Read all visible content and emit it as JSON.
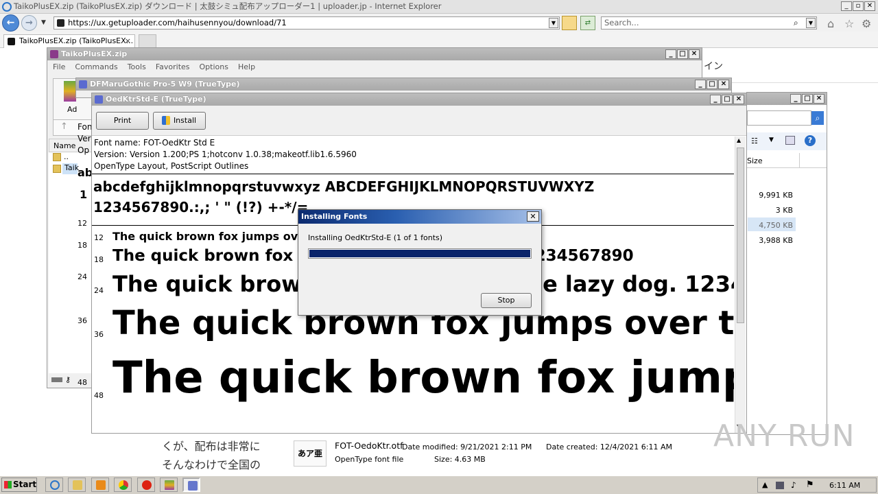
{
  "browser": {
    "title": "TaikoPlusEX.zip (TaikoPlusEX.zip) ダウンロード | 太鼓シミュ配布アップローダー1 | uploader.jp - Internet Explorer",
    "address": "https://ux.getuploader.com/haihusennyou/download/71",
    "search_placeholder": "Search...",
    "tab_label": "TaikoPlusEX.zip (TaikoPlusEX...",
    "tab_close": "×"
  },
  "page": {
    "text_right": "イン",
    "text_line1": "くが、配布は非常に",
    "text_line2": "そんなわけで全国の"
  },
  "winrar": {
    "title": "TaikoPlusEX.zip",
    "menu": [
      "File",
      "Commands",
      "Tools",
      "Favorites",
      "Options",
      "Help"
    ],
    "add_label": "Ad",
    "col_name": "Name",
    "row1": "..",
    "row2": "Taik",
    "left_labels": [
      "Fon",
      "Ver",
      "Op",
      "ab",
      "1",
      "12",
      "18",
      "24",
      "36",
      "48"
    ]
  },
  "dfmaru": {
    "title": "DFMaruGothic Pro-5 W9 (TrueType)"
  },
  "fontviewer": {
    "title": "OedKtrStd-E (TrueType)",
    "print_label": "Print",
    "install_label": "Install",
    "font_name": "Font name: FOT-OedKtr Std E",
    "version": "Version: Version 1.200;PS 1;hotconv 1.0.38;makeotf.lib1.6.5960",
    "outline": "OpenType Layout, PostScript Outlines",
    "charset1": "abcdefghijklmnopqrstuvwxyz ABCDEFGHIJKLMNOPQRSTUVWXYZ",
    "charset2": "1234567890.:,; ' \" (!?) +-*/=",
    "samples": [
      {
        "size": "12",
        "text": "The quick brown fox jumps over the lazy dog. 1234567890"
      },
      {
        "size": "18",
        "text": "The quick brown fox jumps over the lazy dog. 1234567890"
      },
      {
        "size": "24",
        "text": "The quick brown fox jumps over the lazy dog. 1234567890"
      },
      {
        "size": "36",
        "text": "The quick brown fox jumps over the lazy dog."
      },
      {
        "size": "48",
        "text": "The quick brown fox jumps over"
      }
    ],
    "sample_tail_18": "234567890",
    "sample_tail_24": "lazy dog. 123456"
  },
  "dialog": {
    "title": "Installing Fonts",
    "message": "Installing OedKtrStd-E (1 of 1 fonts)",
    "progress": 1.0,
    "stop_label": "Stop"
  },
  "explorer": {
    "col_size": "Size",
    "sizes": [
      "9,991 KB",
      "3 KB",
      "4,750 KB",
      "3,988 KB"
    ]
  },
  "details": {
    "icon_text": "あア亜",
    "filename": "FOT-OedoKtr.otf",
    "modified": "Date modified: 9/21/2021 2:11 PM",
    "created": "Date created: 12/4/2021 6:11 AM",
    "type": "OpenType font file",
    "size": "Size: 4.63 MB"
  },
  "taskbar": {
    "start": "Start",
    "time": "6:11 AM"
  },
  "watermark": "ANY RUN"
}
